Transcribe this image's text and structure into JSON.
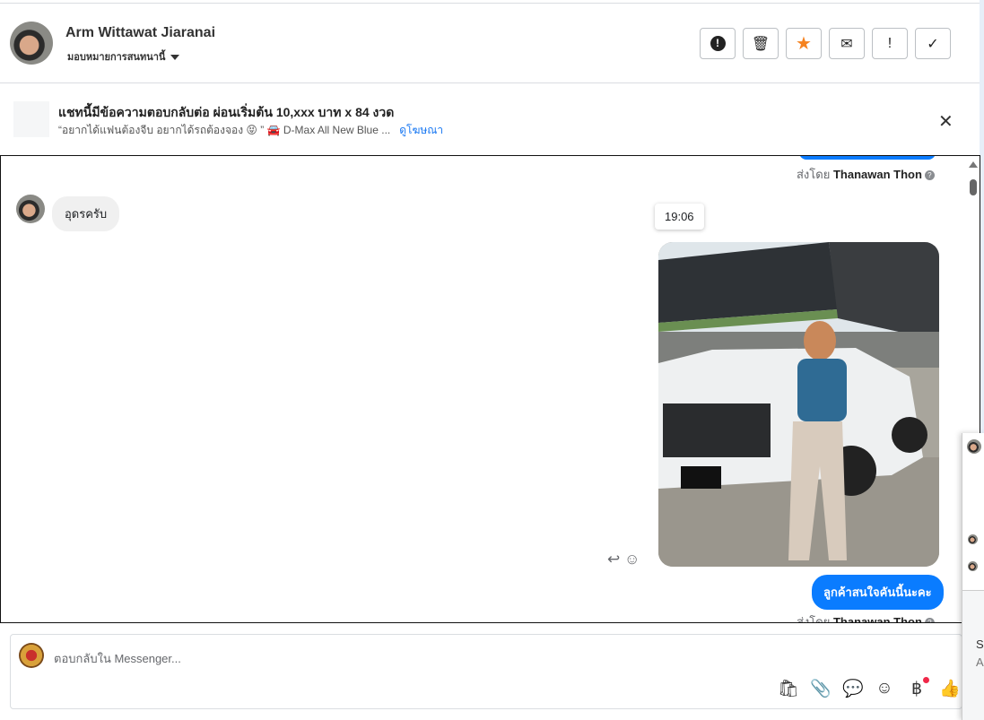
{
  "header": {
    "name": "Arm Wittawat Jiaranai",
    "assign_label": "มอบหมายการสนทนานี้",
    "actions": [
      {
        "icon": "alert-circle-icon",
        "glyph": "❗"
      },
      {
        "icon": "trash-icon",
        "glyph": "🗑"
      },
      {
        "icon": "star-icon",
        "glyph": "★"
      },
      {
        "icon": "envelope-icon",
        "glyph": "✉"
      },
      {
        "icon": "exclamation-icon",
        "glyph": "!"
      },
      {
        "icon": "check-icon",
        "glyph": "✓"
      }
    ]
  },
  "banner": {
    "title": "แชทนี้มีข้อความตอบกลับต่อ ผ่อนเริ่มต้น 10,xxx บาท x 84 งวด",
    "subtitle": "“อยากได้แฟนต้องจีบ อยากได้รถต้องจอง 😝 ” 🚘 D-Max All New Blue ...",
    "link": "ดูโฆษณา",
    "close": "✕"
  },
  "chat": {
    "sent_by_prefix": "ส่งโดย",
    "sender": "Thanawan Thon",
    "incoming": "อุดรครับ",
    "time": "19:06",
    "outgoing": "ลูกค้าสนใจคันนี้นะคะ",
    "reply_glyph": "↩",
    "react_glyph": "☺"
  },
  "composer": {
    "placeholder": "ตอบกลับใน Messenger...",
    "tools": [
      "🛍",
      "📎",
      "💬",
      "☺",
      "฿",
      "👍"
    ]
  },
  "overlay": {
    "line1": "Sc",
    "line2": "A"
  }
}
